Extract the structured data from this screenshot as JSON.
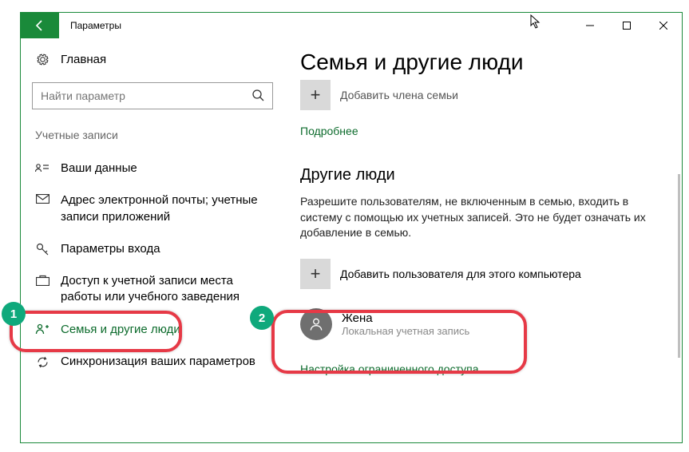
{
  "window": {
    "title": "Параметры"
  },
  "sidebar": {
    "home": "Главная",
    "search_placeholder": "Найти параметр",
    "section": "Учетные записи",
    "items": [
      {
        "label": "Ваши данные"
      },
      {
        "label": "Адрес электронной почты; учетные записи приложений"
      },
      {
        "label": "Параметры входа"
      },
      {
        "label": "Доступ к учетной записи места работы или учебного заведения"
      },
      {
        "label": "Семья и другие люди"
      },
      {
        "label": "Синхронизация ваших параметров"
      }
    ]
  },
  "main": {
    "heading": "Семья и другие люди",
    "add_family": "Добавить члена семьи",
    "more_link": "Подробнее",
    "other_heading": "Другие люди",
    "other_text": "Разрешите пользователям, не включенным в семью, входить в систему с помощью их учетных записей. Это не будет означать их добавление в семью.",
    "add_other": "Добавить пользователя для этого компьютера",
    "user": {
      "name": "Жена",
      "type": "Локальная учетная запись"
    },
    "restricted_link": "Настройка ограниченного доступа"
  },
  "annotations": {
    "badge1": "1",
    "badge2": "2"
  }
}
